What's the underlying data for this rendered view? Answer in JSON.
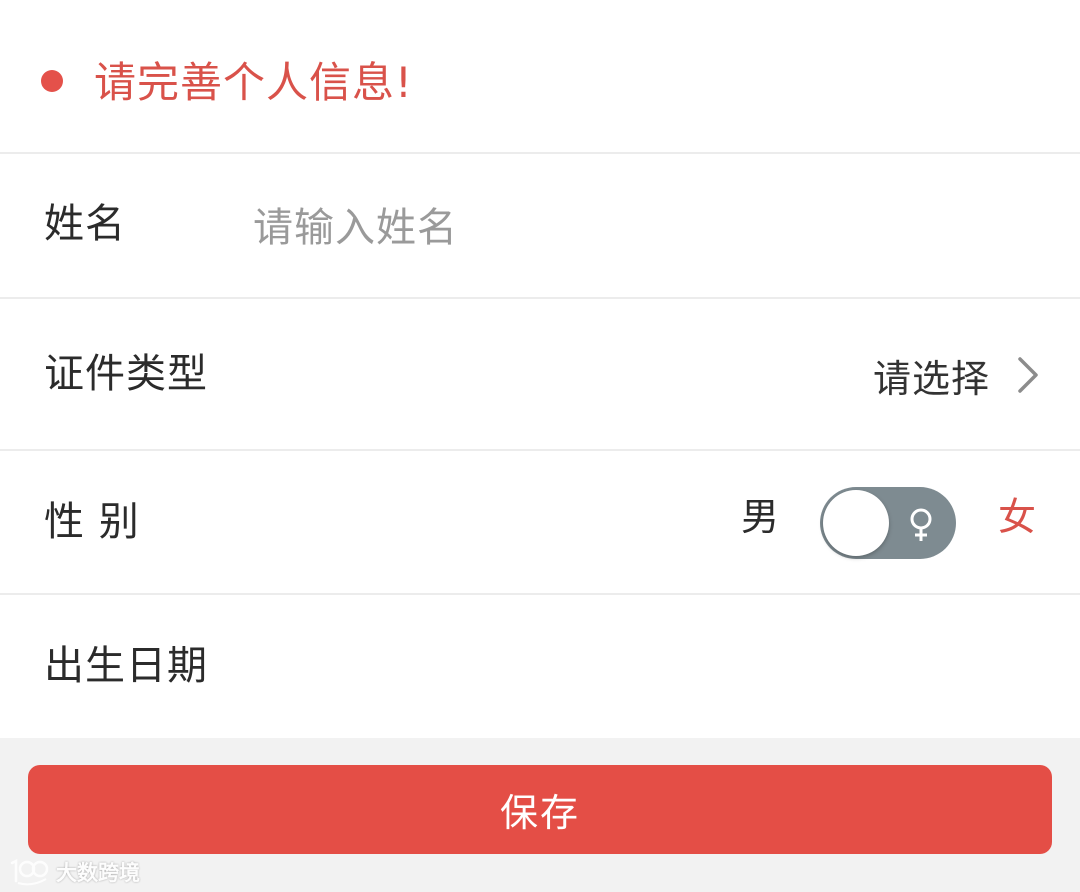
{
  "notice": {
    "text": "请完善个人信息!",
    "color": "#d9524a"
  },
  "form": {
    "name": {
      "label": "姓名",
      "placeholder": "请输入姓名",
      "value": ""
    },
    "id_type": {
      "label": "证件类型",
      "value": "请选择",
      "icon": "chevron-right-icon"
    },
    "gender": {
      "label": "性 别",
      "male_label": "男",
      "female_label": "女",
      "selected": "female",
      "icon": "female-symbol-icon"
    },
    "birth_date": {
      "label": "出生日期",
      "value": ""
    }
  },
  "actions": {
    "save_label": "保存"
  },
  "watermark": {
    "text": "大数跨境",
    "logo": "100"
  },
  "colors": {
    "accent": "#e44e46",
    "toggle_track": "#7e8b91",
    "background": "#f2f2f2"
  }
}
